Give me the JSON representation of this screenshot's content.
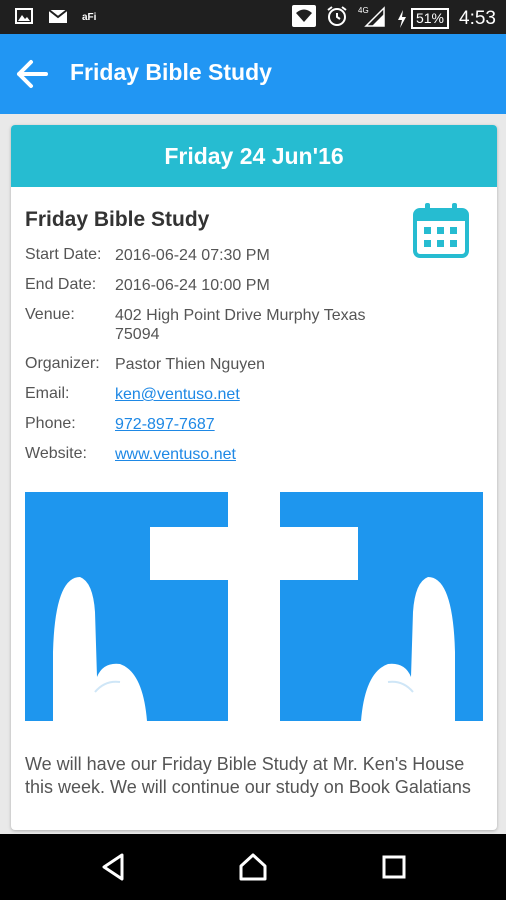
{
  "status_bar": {
    "battery": "51%",
    "time": "4:53"
  },
  "app_bar": {
    "title": "Friday Bible Study"
  },
  "card": {
    "date_header": "Friday 24 Jun'16",
    "event_title": "Friday Bible Study",
    "details": {
      "start_label": "Start Date:",
      "start_value": "2016-06-24 07:30 PM",
      "end_label": "End Date:",
      "end_value": "2016-06-24 10:00 PM",
      "venue_label": "Venue:",
      "venue_value": "402 High Point Drive Murphy Texas 75094",
      "organizer_label": "Organizer:",
      "organizer_value": "Pastor Thien Nguyen",
      "email_label": "Email:",
      "email_value": "ken@ventuso.net",
      "phone_label": "Phone:",
      "phone_value": "972-897-7687",
      "website_label": "Website:",
      "website_value": "www.ventuso.net"
    },
    "description": "We will have our Friday Bible Study at Mr. Ken's House this week. We will continue our study on Book Galatians"
  },
  "icons": {
    "back": "arrow-back-icon",
    "calendar": "calendar-icon",
    "nav_back": "triangle-back-icon",
    "nav_home": "home-icon",
    "nav_recents": "square-recents-icon"
  },
  "colors": {
    "app_bar": "#2196f3",
    "date_header": "#26bcd1",
    "hero_bg": "#1e96ee",
    "link": "#1e88e5"
  }
}
